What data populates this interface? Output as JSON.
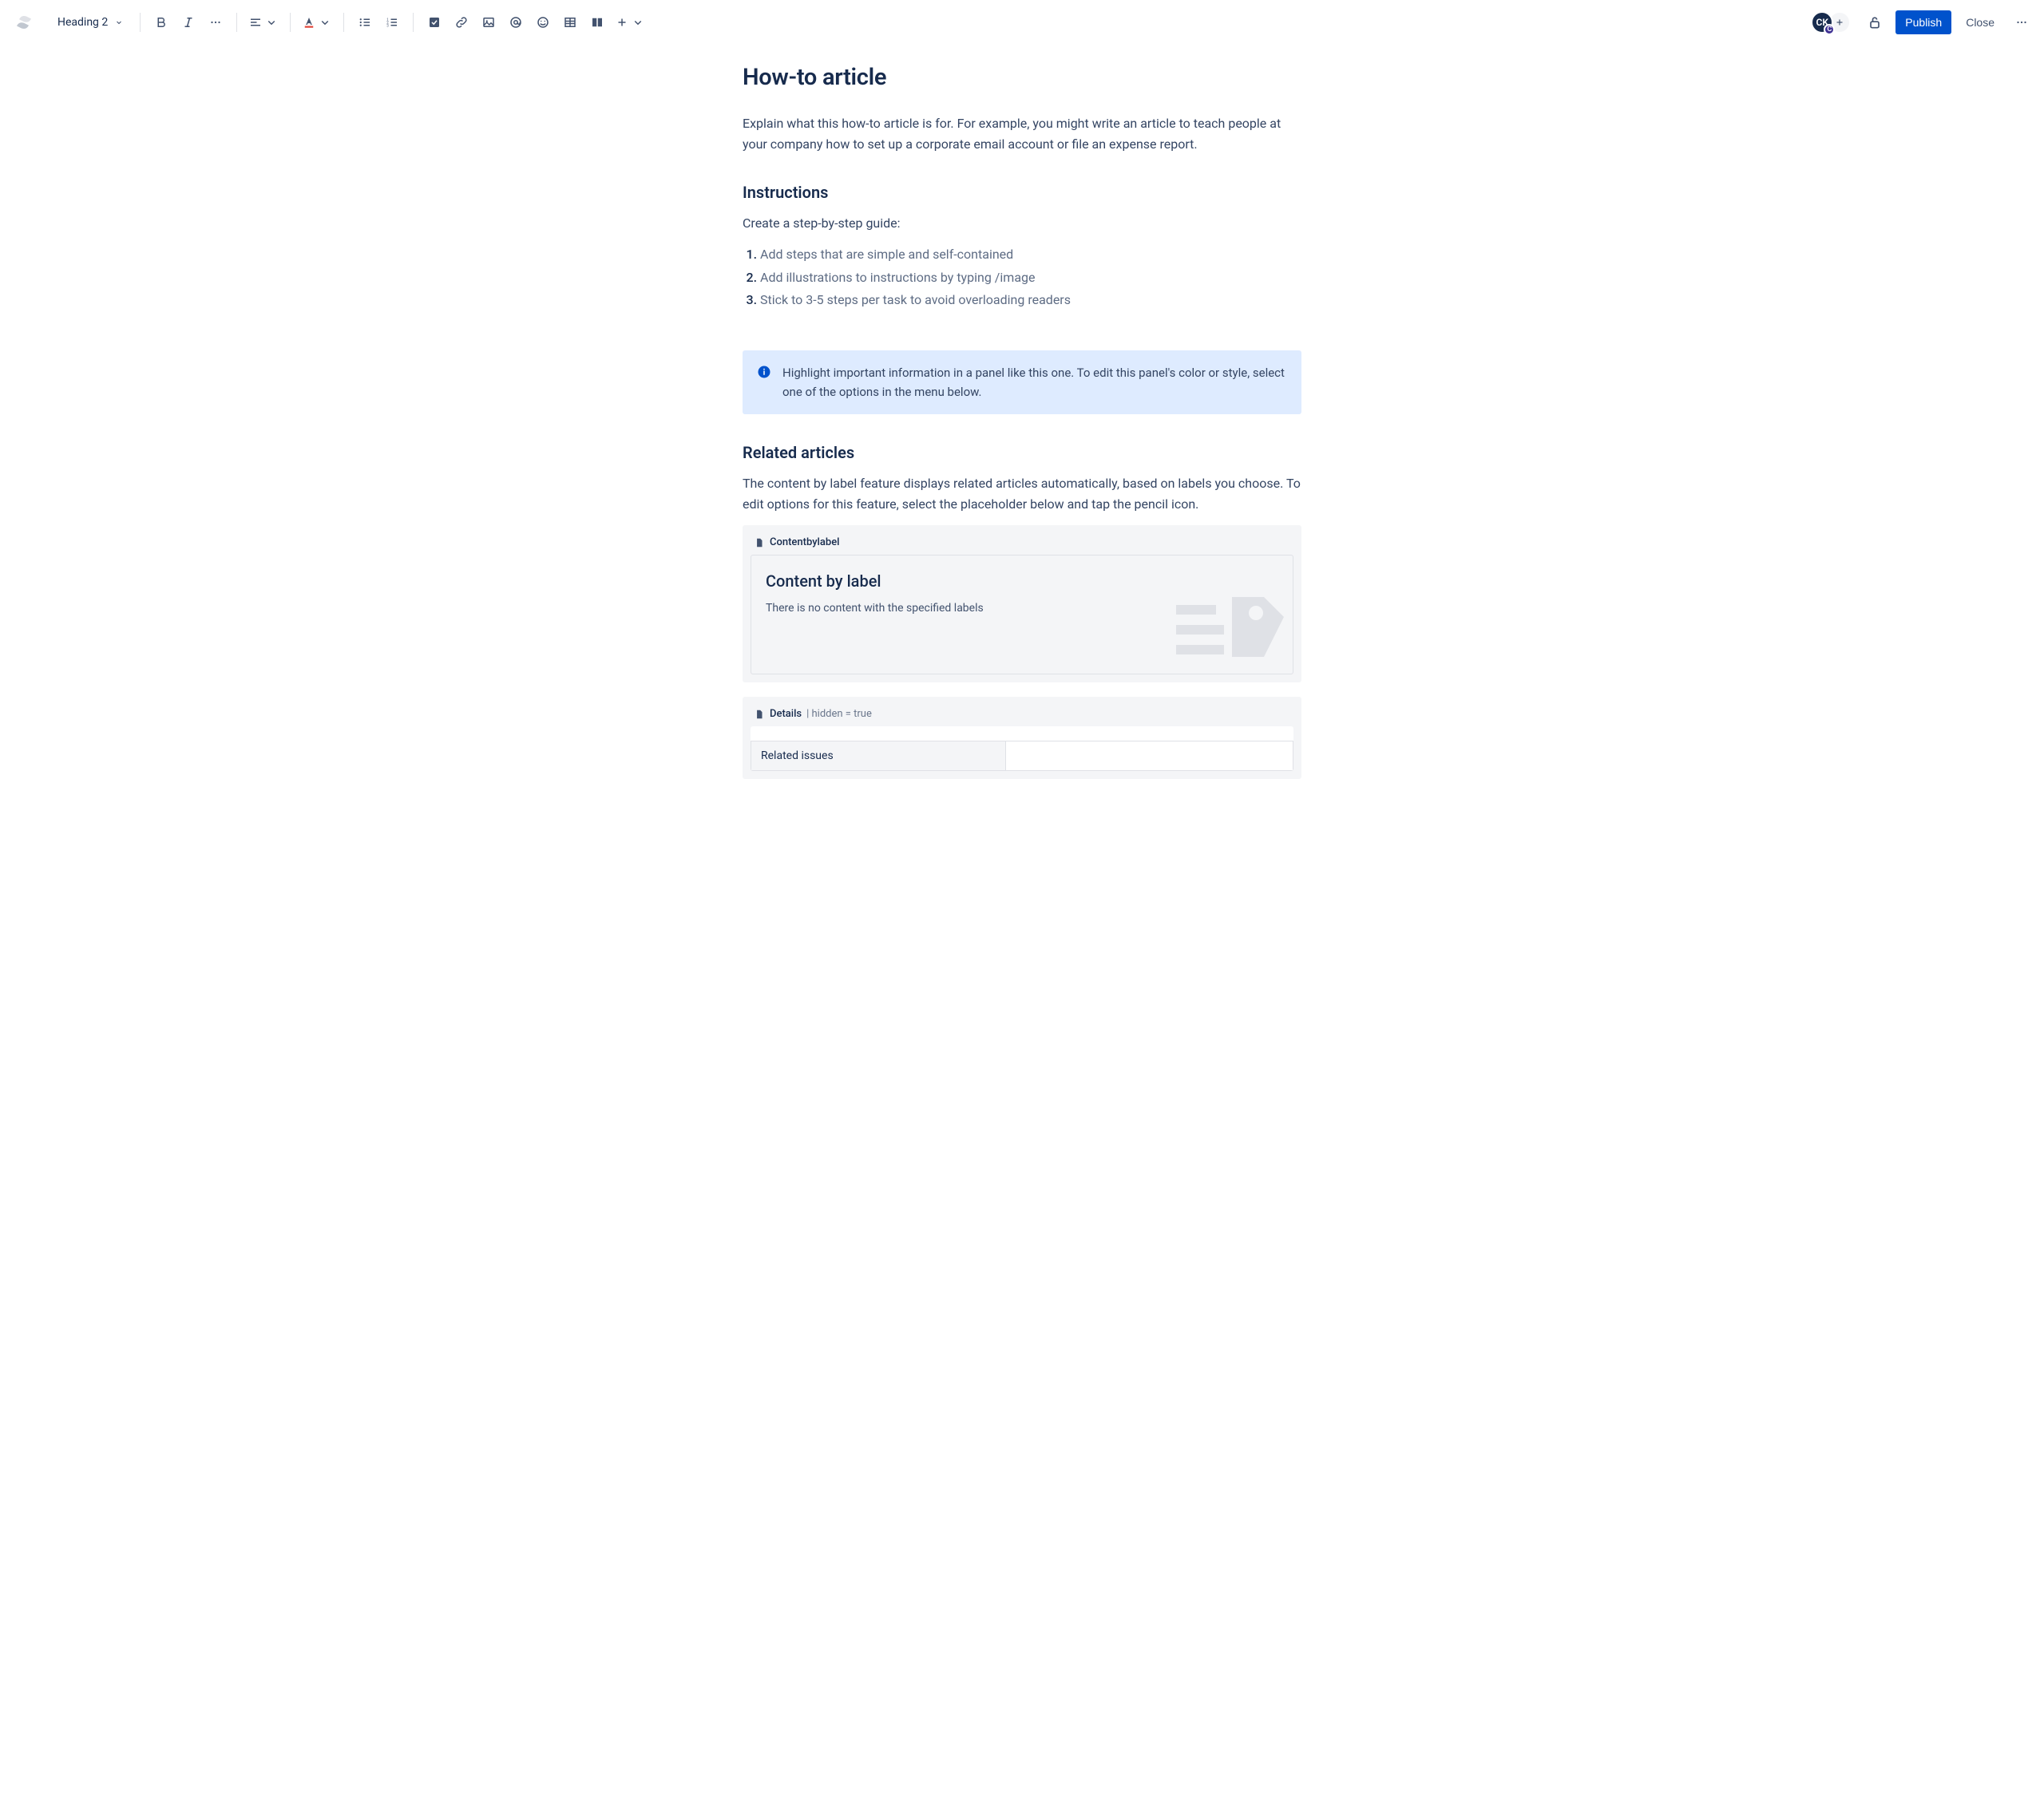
{
  "toolbar": {
    "heading_label": "Heading 2",
    "avatar_initials": "CK",
    "avatar_status": "C",
    "publish_label": "Publish",
    "close_label": "Close"
  },
  "page": {
    "title": "How-to article",
    "intro": "Explain what this how-to article is for. For example, you might write an article to teach people at your company how to set up a corporate email account or file an expense report.",
    "instructions_heading": "Instructions",
    "instructions_intro": "Create a step-by-step guide:",
    "steps": [
      "Add steps that are simple and self-contained",
      "Add illustrations to instructions by typing /image",
      "Stick to 3-5 steps per task to avoid overloading readers"
    ],
    "panel_text": "Highlight important information in a panel like this one. To edit this panel's color or style, select one of the options in the menu below.",
    "related_heading": "Related articles",
    "related_intro": "The content by label feature displays related articles automatically, based on labels you choose. To edit options for this feature, select the placeholder below and tap the pencil icon.",
    "macro1": {
      "name": "Contentbylabel",
      "title": "Content by label",
      "empty": "There is no content with the specified labels"
    },
    "macro2": {
      "name": "Details",
      "meta": "| hidden = true",
      "row_label": "Related issues",
      "row_value": ""
    }
  }
}
